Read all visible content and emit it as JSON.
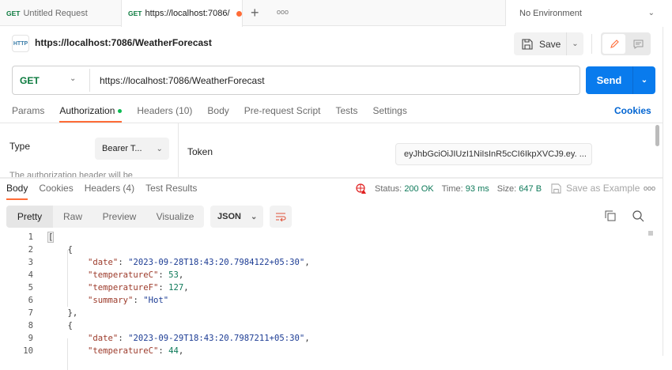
{
  "tabs": [
    {
      "method": "GET",
      "label": "Untitled Request"
    },
    {
      "method": "GET",
      "label": "https://localhost:7086/",
      "unsaved": true
    }
  ],
  "environment": "No Environment",
  "request": {
    "title": "https://localhost:7086/WeatherForecast",
    "method": "GET",
    "url": "https://localhost:7086/WeatherForecast",
    "save_label": "Save",
    "send_label": "Send",
    "http_icon": "HTTP"
  },
  "request_tabs": [
    "Params",
    "Authorization",
    "Headers (10)",
    "Body",
    "Pre-request Script",
    "Tests",
    "Settings"
  ],
  "cookies_label": "Cookies",
  "auth": {
    "type_label": "Type",
    "type_value": "Bearer T...",
    "note": "The authorization header will be",
    "token_label": "Token",
    "token_value": "eyJhbGciOiJIUzI1NiIsInR5cCI6IkpXVCJ9.ey. ..."
  },
  "response_tabs": [
    "Body",
    "Cookies",
    "Headers (4)",
    "Test Results"
  ],
  "status": {
    "status_label": "Status:",
    "status_value": "200 OK",
    "time_label": "Time:",
    "time_value": "93 ms",
    "size_label": "Size:",
    "size_value": "647 B",
    "save_example": "Save as Example"
  },
  "view_modes": [
    "Pretty",
    "Raw",
    "Preview",
    "Visualize"
  ],
  "format": "JSON",
  "code_lines": [
    "1",
    "2",
    "3",
    "4",
    "5",
    "6",
    "7",
    "8",
    "9",
    "10"
  ],
  "json": {
    "r1": {
      "date": "\"2023-09-28T18:43:20.7984122+05:30\"",
      "tempC": "53",
      "tempF": "127",
      "summary": "\"Hot\""
    },
    "r2": {
      "date": "\"2023-09-29T18:43:20.7987211+05:30\"",
      "tempC": "44"
    },
    "keys": {
      "date": "\"date\"",
      "tempC": "\"temperatureC\"",
      "tempF": "\"temperatureF\"",
      "summary": "\"summary\""
    }
  },
  "colors": {
    "accent": "#ff6c37",
    "send": "#097bed",
    "get": "#0b7a3e"
  }
}
